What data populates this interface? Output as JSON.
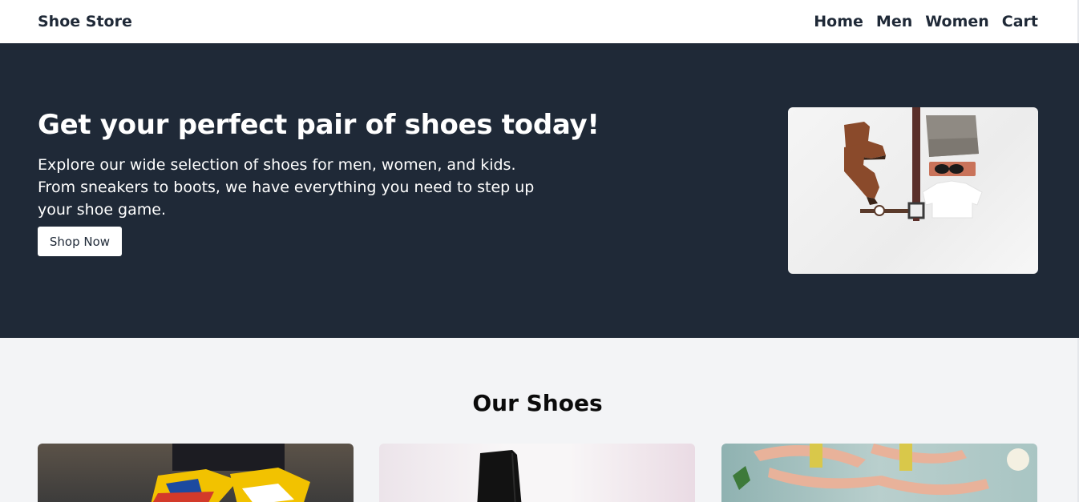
{
  "nav": {
    "brand": "Shoe Store",
    "links": [
      "Home",
      "Men",
      "Women",
      "Cart"
    ]
  },
  "hero": {
    "title": "Get your perfect pair of shoes today!",
    "text": "Explore our wide selection of shoes for men, women, and kids. From sneakers to boots, we have everything you need to step up your shoe game.",
    "button_label": "Shop Now",
    "image_icon": "flat-lay-outfit-image"
  },
  "products": {
    "title": "Our Shoes",
    "cards": [
      {
        "image_icon": "sneakers-image"
      },
      {
        "image_icon": "black-boot-image"
      },
      {
        "image_icon": "sandals-image"
      }
    ]
  },
  "colors": {
    "hero_bg": "#1f2937",
    "page_bg": "#f3f4f6",
    "nav_text": "#1f2937"
  }
}
